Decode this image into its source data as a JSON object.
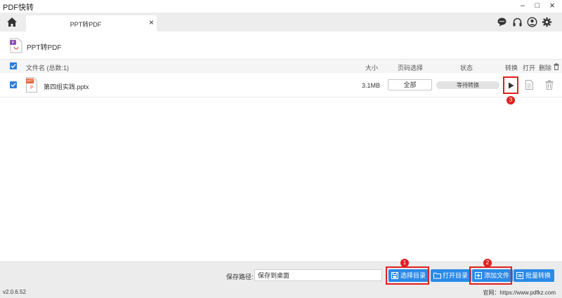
{
  "window": {
    "title": "PDF快转",
    "minimize": "–",
    "maximize": "□",
    "close": "×"
  },
  "tabs": [
    {
      "label": "PPT转PDF",
      "close": "×"
    }
  ],
  "toolbar_icons": [
    "chat-icon",
    "headset-icon",
    "user-icon",
    "gear-icon"
  ],
  "section": {
    "title": "PPT转PDF"
  },
  "list": {
    "headers": {
      "filename": "文件名 (总数:1)",
      "size": "大小",
      "page_select": "页码选择",
      "status": "状态",
      "convert": "转换",
      "open": "打开",
      "delete": "删除"
    },
    "rows": [
      {
        "filename": "第四组实践.pptx",
        "size": "3.1MB",
        "page_select": "全部",
        "status": "等待转换",
        "checked": true
      }
    ]
  },
  "bottom": {
    "path_label": "保存路径:",
    "path_value": "保存到桌面",
    "btn_select_dir": "选择目录",
    "btn_open_dir": "打开目录",
    "btn_add_file": "添加文件",
    "btn_batch_convert": "批量转换"
  },
  "annotations": {
    "badge1": "1",
    "badge2": "2",
    "badge3": "3"
  },
  "status_bar": {
    "version": "v2.0.6.52",
    "website": "官网：https://www.pdfkz.com"
  },
  "colors": {
    "accent": "#2b8ae8",
    "highlight": "#e02020",
    "ppt_orange": "#e8592b",
    "pdf_purple": "#8e4fb5"
  }
}
